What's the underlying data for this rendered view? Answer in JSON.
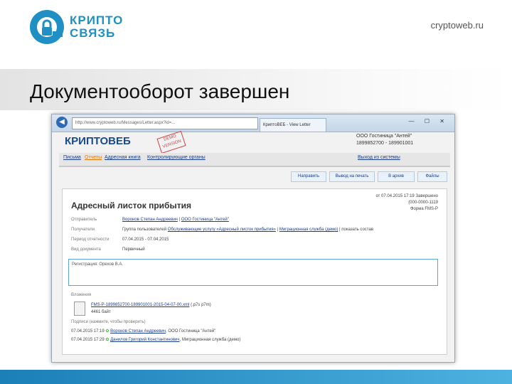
{
  "header": {
    "logo_text_line1": "КРИПТО",
    "logo_text_line2": "СВЯЗЬ",
    "site_url": "cryptoweb.ru"
  },
  "slide": {
    "title": "Документооборот завершен"
  },
  "screenshot": {
    "browser": {
      "address": "http://www.cryptoweb.ru/Messages/Letter.aspx?id=...",
      "tab_label": "КриптоВЕБ - View Letter",
      "window_controls": "— ☐ ✕"
    },
    "app_logo": "КРИПТОВЕБ",
    "stamp": "DEMO VERSION",
    "org": {
      "name": "ООО Гостиница \"Антей\"",
      "codes": "1899852700 - 189901001"
    },
    "nav": {
      "letters": "Письма",
      "reports": "Отчеты",
      "address_book": "Адресная книга",
      "control_bodies": "Контролирующие органы",
      "logout": "Выход из системы"
    },
    "toolbar": {
      "forward": "Направить",
      "print": "Вывод на печать",
      "archive": "В архив",
      "files": "Файлы"
    },
    "document": {
      "title": "Адресный листок прибытия",
      "date_line": "от 07.04.2015 17:19  Завершено",
      "doc_number": "(000-0000-1119",
      "doc_form": "Форма FMS-P",
      "sender_label": "Отправитель",
      "sender_person": "Воронов Степан Андреевич",
      "sender_org": "ООО Гостиница \"Антей\"",
      "recipients_label": "Получатели",
      "recipients_prefix": "Группа пользователей",
      "recipients_group": "Обслуживающие услугу «Адресный листок прибытия»",
      "recipients_service": "Миграционная служба (демо)",
      "recipients_suffix": "показать состав",
      "period_label": "Период отчетности",
      "period_value": "07.04.2015 - 07.04.2015",
      "doctype_label": "Вид документа",
      "doctype_value": "Первичный",
      "note": "Регистрация: Орехов В.А.",
      "attachments_label": "Вложения",
      "file_name": "FMS-P-1899852700-189901001-2015-04-07-00.xml",
      "file_sig": "(.p7s p7m)",
      "file_size": "4461 байт",
      "signatures_label": "Подписи (нажмите, чтобы проверить)",
      "sig1_date": "07.04.2015 17:19",
      "sig1_name": "Воронов Степан Андреевич",
      "sig1_org": ", ООО Гостиница \"Антей\"",
      "sig2_date": "07.04.2015 17:29",
      "sig2_name": "Данилов Григорий Константинович",
      "sig2_org": ", Миграционная служба (демо)"
    }
  }
}
